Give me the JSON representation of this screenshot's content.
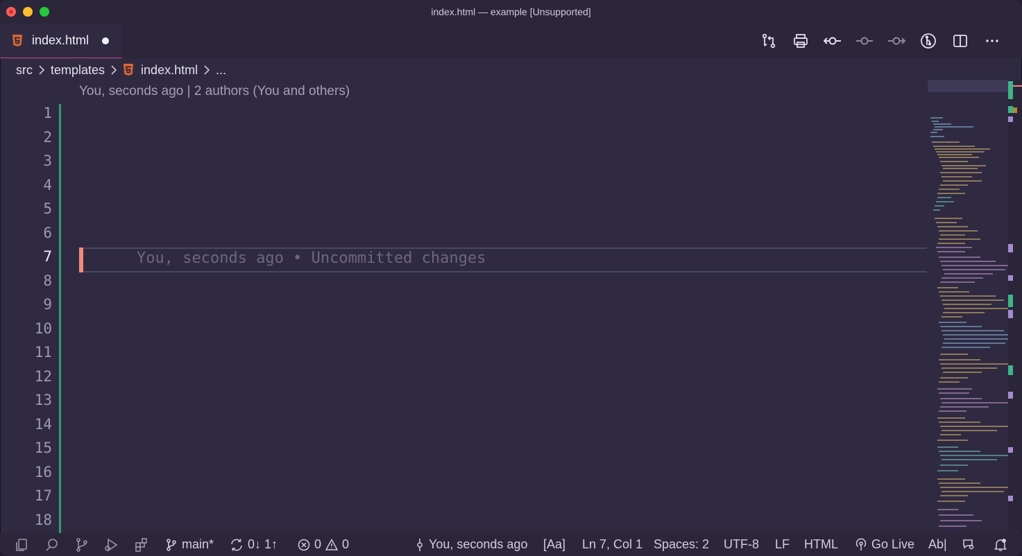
{
  "window": {
    "title": "index.html — example [Unsupported]"
  },
  "tab": {
    "label": "index.html",
    "icon": "html5-icon",
    "modified": true
  },
  "toolbar": {
    "actions": [
      "open-changes-icon",
      "print-icon",
      "git-commit-icon",
      "previous-change-icon",
      "next-change-icon",
      "git-graph-icon",
      "split-editor-icon",
      "more-actions-icon"
    ]
  },
  "breadcrumb": {
    "items": [
      "src",
      "templates",
      "index.html",
      "..."
    ]
  },
  "editor": {
    "blame_header": "You, seconds ago | 2 authors (You and others)",
    "line_numbers": [
      "1",
      "2",
      "3",
      "4",
      "5",
      "6",
      "7",
      "8",
      "9",
      "10",
      "11",
      "12",
      "13",
      "14",
      "15",
      "16",
      "17",
      "18"
    ],
    "active_line": "7",
    "inline_blame": "You, seconds ago • Uncommitted changes"
  },
  "statusbar": {
    "branch": "main*",
    "sync": "0↓ 1↑",
    "errors": "0",
    "warnings": "0",
    "blame": "You, seconds ago",
    "case_toggle": "[Aa]",
    "position": "Ln 7, Col 1",
    "indent": "Spaces: 2",
    "encoding": "UTF-8",
    "eol": "LF",
    "language": "HTML",
    "golive": "Go Live",
    "spell": "Ab|"
  },
  "colors": {
    "accent": "#c74a8c",
    "git_added": "#2f9e6e",
    "cursor_marker": "#f08a7c",
    "background": "#2f2a42",
    "html_icon": "#e0652e"
  }
}
